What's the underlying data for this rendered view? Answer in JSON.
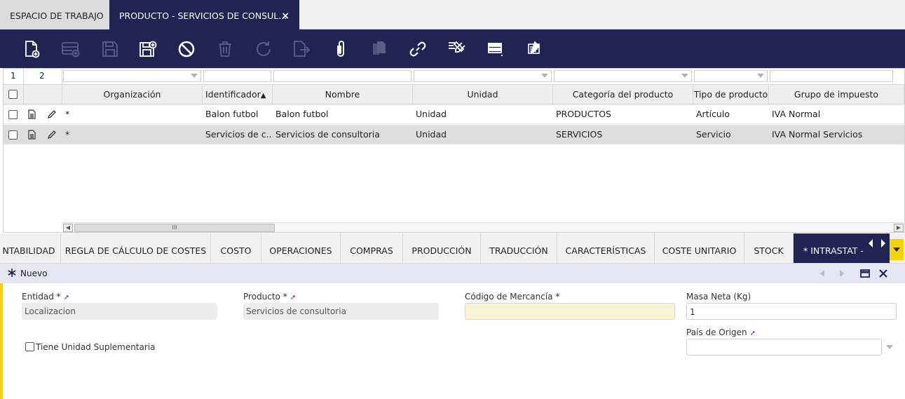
{
  "tabs": {
    "workspace": "ESPACIO DE TRABAJO",
    "active": "PRODUCTO - SERVICIOS DE CONSUL...",
    "close": "×"
  },
  "grid": {
    "selected_count": "1",
    "total_count": "2",
    "columns": [
      "Organización",
      "Identificador",
      "Nombre",
      "Unidad",
      "Categoría del producto",
      "Tipo de producto",
      "Grupo de impuesto"
    ],
    "sort_indicator": "▲",
    "rows": [
      {
        "org": "*",
        "id": "Balon futbol",
        "name": "Balon futbol",
        "unit": "Unidad",
        "category": "PRODUCTOS",
        "type": "Artículo",
        "tax": "IVA Normal"
      },
      {
        "org": "*",
        "id": "Servicios de c...",
        "name": "Servicios de consultoria",
        "unit": "Unidad",
        "category": "SERVICIOS",
        "type": "Servicio",
        "tax": "IVA Normal Servicios"
      }
    ],
    "scroll_thumb_glyph": "III"
  },
  "subtabs": [
    "NTABILIDAD",
    "REGLA DE CÁLCULO DE COSTES",
    "COSTO",
    "OPERACIONES",
    "COMPRAS",
    "PRODUCCIÓN",
    "TRADUCCIÓN",
    "CARACTERÍSTICAS",
    "COSTE UNITARIO",
    "STOCK",
    "* INTRASTAT -"
  ],
  "form": {
    "status": "Nuevo",
    "entidad_label": "Entidad *",
    "entidad_value": "Localizacion",
    "producto_label": "Producto *",
    "producto_value": "Servicios de consultoria",
    "codigo_label": "Código de Mercancía *",
    "codigo_value": "",
    "masa_label": "Masa Neta (Kg)",
    "masa_value": "1",
    "pais_label": "País de Origen",
    "pais_value": "",
    "unidad_sup_label": "Tiene Unidad Suplementaria"
  },
  "colors": {
    "nav_dark": "#202452",
    "accent_yellow": "#f5d300",
    "required_bg": "#fbf4d4",
    "link_arrow": "#6a1b9a"
  },
  "icons": [
    "new-document-icon",
    "new-row-icon",
    "save-icon",
    "save-new-icon",
    "undo-icon",
    "delete-icon",
    "refresh-icon",
    "export-icon",
    "attach-icon",
    "copy-icon",
    "link-icon",
    "tools-icon",
    "form-view-icon",
    "audit-icon"
  ]
}
